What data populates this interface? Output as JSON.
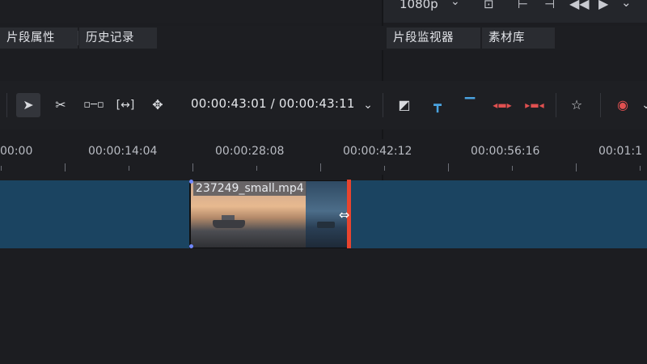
{
  "monitor": {
    "resolution": "1080p"
  },
  "tabs_left": [
    {
      "label": "片段属性"
    },
    {
      "label": "历史记录"
    }
  ],
  "tabs_right": [
    {
      "label": "片段监视器"
    },
    {
      "label": "素材库"
    }
  ],
  "toolbar": {
    "timecode": "00:00:43:01 / 00:00:43:11",
    "tools": [
      "select-tool",
      "razor-tool",
      "ripple-tool",
      "slip-tool",
      "spacer-tool"
    ],
    "right_tools": [
      "overwrite-icon",
      "insert-icon",
      "lift-icon",
      "extract-icon",
      "extract-range-icon",
      "favorite-icon",
      "record-icon"
    ]
  },
  "ruler": {
    "labels": [
      "00:00",
      "00:00:14:04",
      "00:00:28:08",
      "00:00:42:12",
      "00:00:56:16",
      "00:01:1"
    ]
  },
  "track": {
    "clip_name": "237249_small.mp4",
    "colors": {
      "track": "#1b4461",
      "playhead": "#e8442e"
    }
  }
}
